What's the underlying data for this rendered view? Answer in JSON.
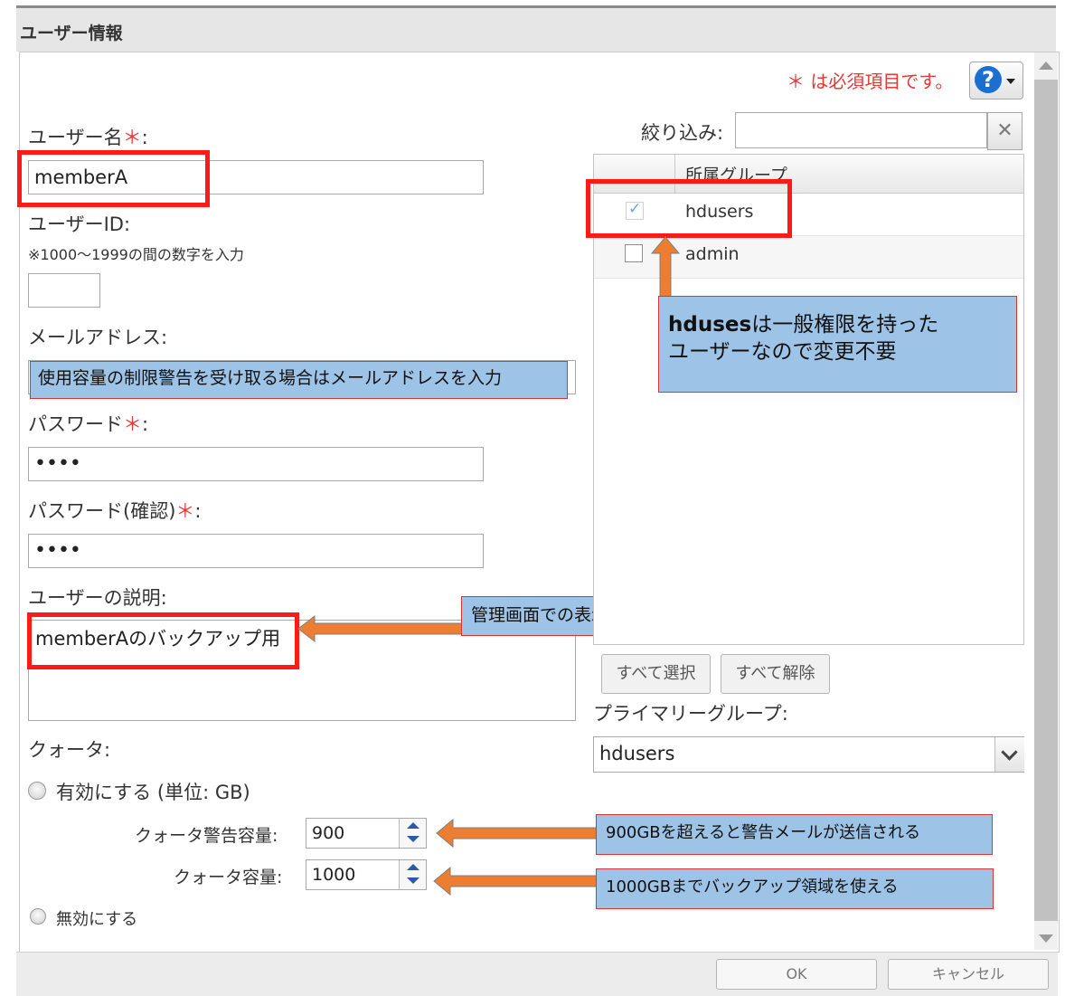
{
  "dialog": {
    "title": "ユーザー情報"
  },
  "header": {
    "required_note": "＊ は必須項目です。",
    "help_icon": "question-mark-icon"
  },
  "form": {
    "username": {
      "label": "ユーザー名",
      "required_mark": "＊",
      "colon": ":",
      "value": "memberA"
    },
    "user_id": {
      "label": "ユーザーID:",
      "hint": "※1000～1999の間の数字を入力",
      "value": ""
    },
    "email": {
      "label": "メールアドレス:",
      "value": ""
    },
    "password": {
      "label": "パスワード",
      "required_mark": "＊",
      "colon": ":",
      "value": "••••"
    },
    "password_confirm": {
      "label": "パスワード(確認)",
      "required_mark": "＊",
      "colon": ":",
      "value": "••••"
    },
    "description": {
      "label": "ユーザーの説明:",
      "value": "memberAのバックアップ用"
    },
    "quota": {
      "label": "クォータ:",
      "enable_label": "有効にする (単位: GB)",
      "warning_label": "クォータ警告容量:",
      "warning_value": "900",
      "capacity_label": "クォータ容量:",
      "capacity_value": "1000",
      "disable_label": "無効にする"
    }
  },
  "groups": {
    "filter_label": "絞り込み:",
    "filter_value": "",
    "column_header": "所属グループ",
    "rows": [
      {
        "name": "hdusers",
        "checked": true
      },
      {
        "name": "admin",
        "checked": false
      }
    ],
    "select_all": "すべて選択",
    "deselect_all": "すべて解除",
    "primary_label": "プライマリーグループ:",
    "primary_value": "hdusers"
  },
  "annotations": {
    "email_note": "使用容量の制限警告を受け取る場合はメールアドレスを入力",
    "hdusers_note_bold": "hduses",
    "hdusers_note_line1": "は一般権限を持った",
    "hdusers_note_line2": "ユーザーなので変更不要",
    "description_note": "管理画面での表示内容",
    "warning_note": "900GBを超えると警告メールが送信される",
    "capacity_note": "1000GBまでバックアップ領域を使える"
  },
  "footer": {
    "ok": "OK",
    "cancel": "キャンセル"
  },
  "colors": {
    "annotation_fill": "#9dc3e6",
    "arrow": "#ed7d31",
    "highlight": "#ff1a1a",
    "required": "#e53935"
  }
}
